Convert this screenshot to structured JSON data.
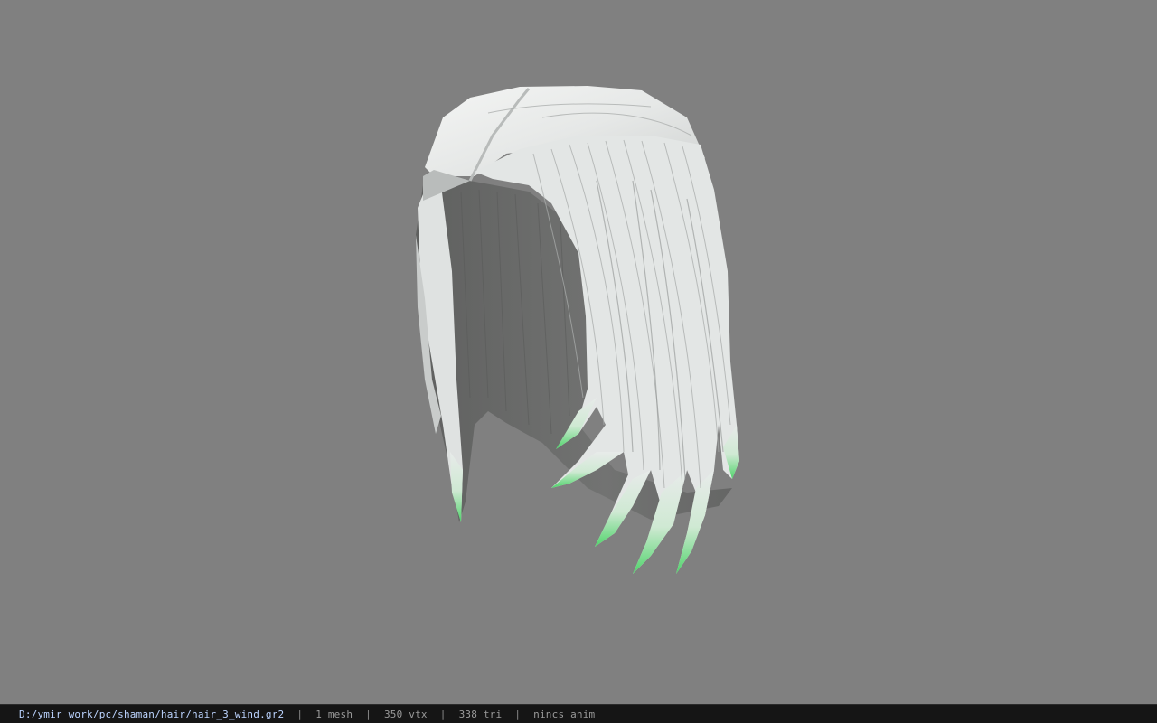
{
  "viewport": {
    "background_color": "#808080",
    "model": {
      "subject": "hair-mesh",
      "primary_color": "#e8ebea",
      "inner_color": "#6f706f",
      "tip_tint_color": "#4fd46a"
    }
  },
  "status_bar": {
    "file_path": "D:/ymir work/pc/shaman/hair/hair_3_wind.gr2",
    "separator": "|",
    "mesh_count": "1 mesh",
    "vertex_count": "350 vtx",
    "triangle_count": "338 tri",
    "anim_label": "nincs anim"
  }
}
